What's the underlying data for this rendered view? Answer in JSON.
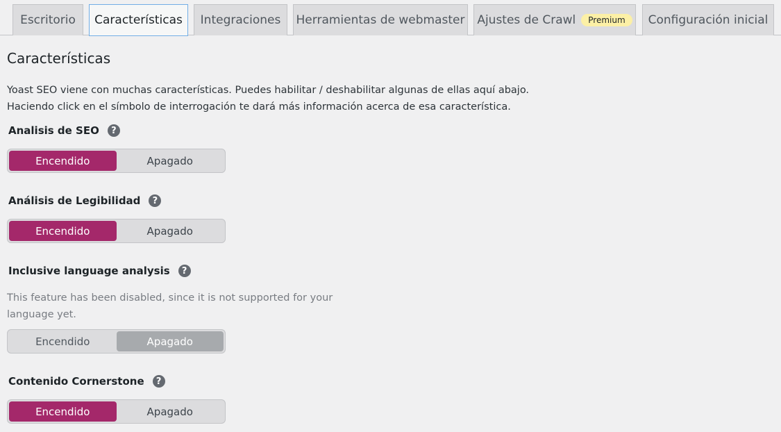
{
  "tabs": [
    {
      "label": "Escritorio"
    },
    {
      "label": "Características"
    },
    {
      "label": "Integraciones"
    },
    {
      "label": "Herramientas de webmaster"
    },
    {
      "label": "Ajustes de Crawl",
      "badge": "Premium"
    },
    {
      "label": "Configuración inicial"
    }
  ],
  "page": {
    "title": "Características",
    "intro_line1": "Yoast SEO viene con muchas características. Puedes habilitar / deshabilitar algunas de ellas aquí abajo.",
    "intro_line2": "Haciendo click en el símbolo de interrogación te dará más información acerca de esa característica."
  },
  "help_symbol": "?",
  "features": [
    {
      "label": "Analisis de SEO",
      "on_label": "Encendido",
      "off_label": "Apagado",
      "selected": "Encendido"
    },
    {
      "label": "Análisis de Legibilidad",
      "on_label": "Encendido",
      "off_label": "Apagado",
      "selected": "Encendido"
    },
    {
      "label": "Inclusive language analysis",
      "note": "This feature has been disabled, since it is not supported for your language yet.",
      "on_label": "Encendido",
      "off_label": "Apagado",
      "selected": "Apagado",
      "disabled": true
    },
    {
      "label": "Contenido Cornerstone",
      "on_label": "Encendido",
      "off_label": "Apagado",
      "selected": "Encendido"
    }
  ],
  "colors": {
    "accent": "#a4286a",
    "disabled_selected": "#a7aaad",
    "active_tab_border": "#72aee6",
    "premium_badge": "#fcf0a6"
  }
}
